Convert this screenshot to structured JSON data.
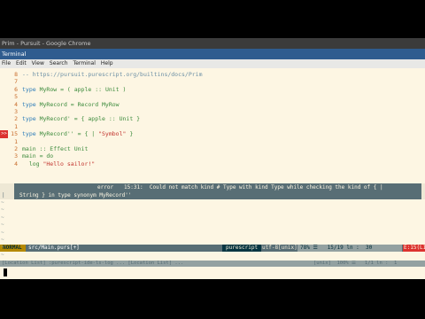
{
  "window": {
    "chrome_title": "Prim - Pursuit - Google Chrome",
    "terminal_title": "Terminal"
  },
  "menu": [
    "File",
    "Edit",
    "View",
    "Search",
    "Terminal",
    "Help"
  ],
  "editor": {
    "lines": [
      {
        "num": "8",
        "segments": [
          {
            "t": "-- https://pursuit.purescript.org/builtins/docs/Prim",
            "c": "cmt"
          }
        ]
      },
      {
        "num": "7",
        "segments": []
      },
      {
        "num": "6",
        "segments": [
          {
            "t": "type ",
            "c": "kw"
          },
          {
            "t": "MyRow",
            "c": "ty"
          },
          {
            "t": " = ( apple :: Unit )",
            "c": "ty"
          }
        ]
      },
      {
        "num": "5",
        "segments": []
      },
      {
        "num": "4",
        "segments": [
          {
            "t": "type ",
            "c": "kw"
          },
          {
            "t": "MyRecord = Record MyRow",
            "c": "ty"
          }
        ]
      },
      {
        "num": "3",
        "segments": []
      },
      {
        "num": "2",
        "segments": [
          {
            "t": "type ",
            "c": "kw"
          },
          {
            "t": "MyRecord' = { apple :: Unit }",
            "c": "ty"
          }
        ]
      },
      {
        "num": "1",
        "segments": []
      },
      {
        "num": "15",
        "sign": ">>",
        "segments": [
          {
            "t": "type ",
            "c": "kw"
          },
          {
            "t": "MyRecord'' = { | ",
            "c": "ty"
          },
          {
            "t": "\"Symbol\"",
            "c": "str"
          },
          {
            "t": " }",
            "c": "ty"
          }
        ]
      },
      {
        "num": "1",
        "segments": []
      },
      {
        "num": "2",
        "segments": [
          {
            "t": "main :: Effect Unit",
            "c": "ty"
          }
        ]
      },
      {
        "num": "3",
        "segments": [
          {
            "t": "main = do",
            "c": "ty"
          }
        ]
      },
      {
        "num": "4",
        "segments": [
          {
            "t": "  log ",
            "c": "ty"
          },
          {
            "t": "\"Hello sailor!\"",
            "c": "str"
          }
        ]
      }
    ]
  },
  "statusline": {
    "mode": "NORMAL",
    "file": "src/Main.purs[+]",
    "filetype": "purescript",
    "encoding": "utf-8[unix]",
    "position": "78% ☰   15/19 ln :  30",
    "error_indicator": "E:15(L15)"
  },
  "error_window": {
    "line_marker": "|",
    "tag": "error",
    "message1": "15:31:  Could not match kind # Type with kind Type while checking the kind of { |",
    "message2": "String } in type synonym MyRecord''"
  },
  "tildes": [
    "~",
    "~",
    "~",
    "~",
    "~",
    "~",
    "~",
    "~"
  ],
  "statusline2": {
    "left": "[Location List] :purescript-ide-ls-log ... [Location List] ...",
    "right": "[unix]  100% ☰   1/1 ln :  1"
  }
}
